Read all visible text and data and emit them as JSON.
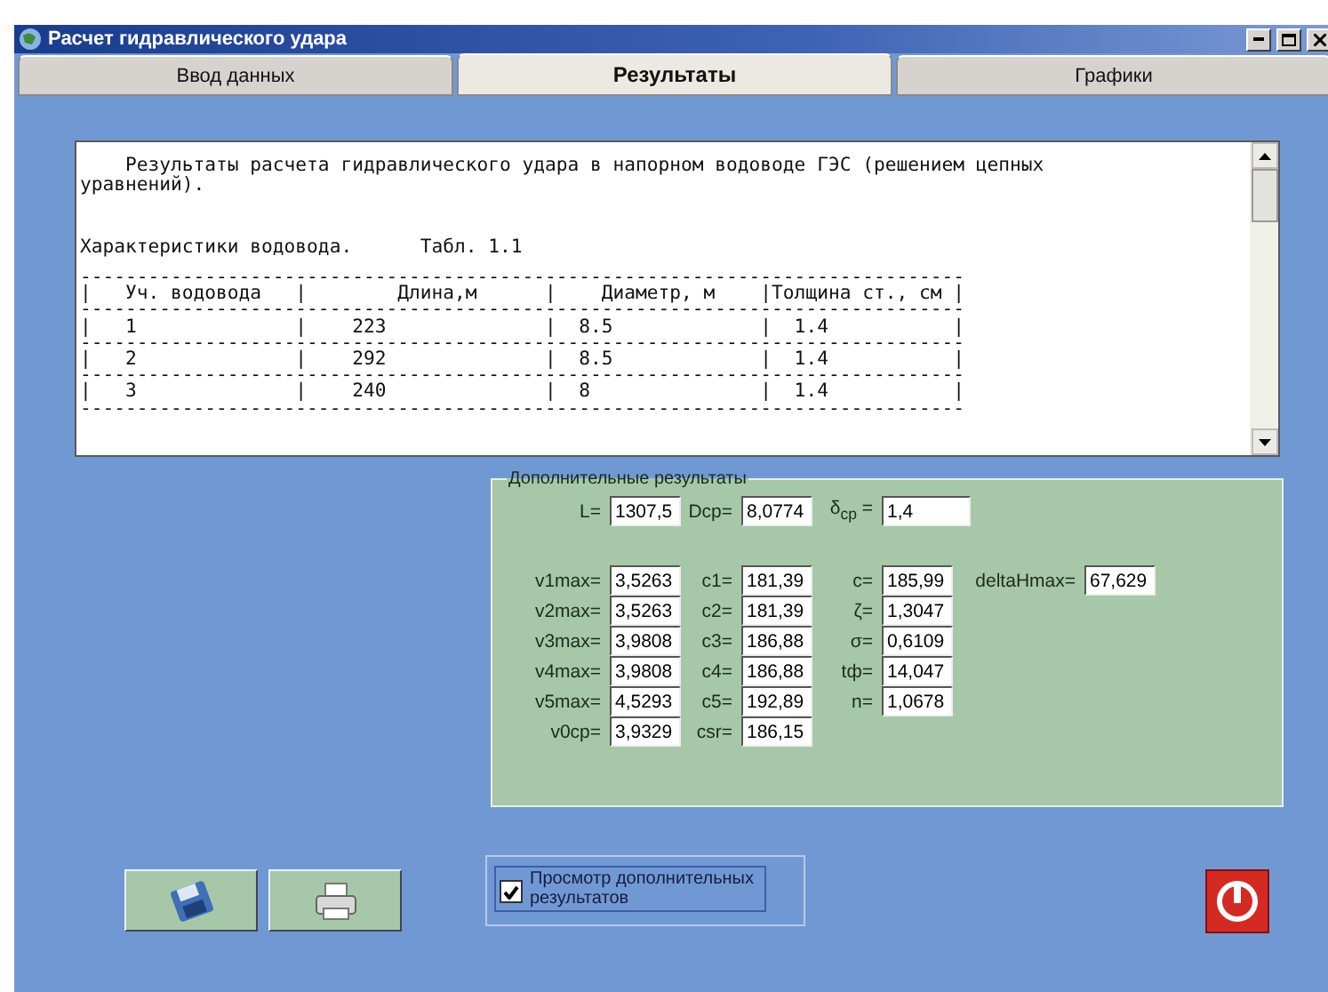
{
  "window": {
    "title": "Расчет гидравлического удара"
  },
  "tabs": [
    {
      "label": "Ввод данных",
      "selected": false
    },
    {
      "label": "Результаты",
      "selected": true
    },
    {
      "label": "Графики",
      "selected": false
    }
  ],
  "report": {
    "heading": [
      "    Результаты расчета гидравлического удара в напорном водоводе ГЭС (решением цепных",
      "уравнений)."
    ],
    "caption": "Характеристики водовода.      Табл. 1.1",
    "table_lines": [
      "------------------------------------------------------------------------------",
      "|   Уч. водовода   |        Длина,м      |    Диаметр, м    |Толщина ст., см |",
      "------------------------------------------------------------------------------",
      "|   1              |    223              |  8.5             |  1.4           |",
      "------------------------------------------------------------------------------",
      "|   2              |    292              |  8.5             |  1.4           |",
      "------------------------------------------------------------------------------",
      "|   3              |    240              |  8               |  1.4           |",
      "------------------------------------------------------------------------------"
    ]
  },
  "extra_results": {
    "title": "Дополнительные результаты",
    "summary": [
      {
        "label": "L=",
        "value": "1307,5"
      },
      {
        "label": "Dcp=",
        "value": "8,0774"
      },
      {
        "label": "δ$_{cp}$ =",
        "value": "1,4"
      }
    ],
    "rows": [
      [
        {
          "label": "v1max=",
          "value": "3,5263"
        },
        {
          "label": "c1=",
          "value": "181,39"
        },
        {
          "label": "c=",
          "value": "185,99"
        },
        {
          "label": "deltaHmax=",
          "value": "67,629"
        }
      ],
      [
        {
          "label": "v2max=",
          "value": "3,5263"
        },
        {
          "label": "c2=",
          "value": "181,39"
        },
        {
          "label": "ζ=",
          "value": "1,3047"
        }
      ],
      [
        {
          "label": "v3max=",
          "value": "3,9808"
        },
        {
          "label": "c3=",
          "value": "186,88"
        },
        {
          "label": "σ=",
          "value": "0,6109"
        }
      ],
      [
        {
          "label": "v4max=",
          "value": "3,9808"
        },
        {
          "label": "c4=",
          "value": "186,88"
        },
        {
          "label": "tф=",
          "value": "14,047"
        }
      ],
      [
        {
          "label": "v5max=",
          "value": "4,5293"
        },
        {
          "label": "c5=",
          "value": "192,89"
        },
        {
          "label": "n=",
          "value": "1,0678"
        }
      ],
      [
        {
          "label": "v0cp=",
          "value": "3,9329"
        },
        {
          "label": "csr=",
          "value": "186,15"
        }
      ]
    ]
  },
  "toolbar": [
    {
      "kind": "save"
    },
    {
      "kind": "print"
    }
  ],
  "show_extra": {
    "label": "Просмотр дополнительных результатов",
    "checked": true
  },
  "exit_button": {
    "kind": "power"
  }
}
